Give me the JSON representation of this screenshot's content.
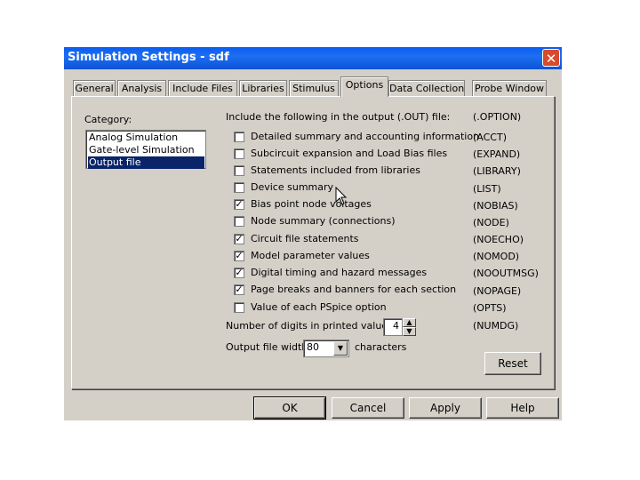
{
  "window": {
    "title": "Simulation Settings - sdf",
    "close_glyph": "✕"
  },
  "tabs": [
    {
      "label": "General"
    },
    {
      "label": "Analysis"
    },
    {
      "label": "Include Files"
    },
    {
      "label": "Libraries"
    },
    {
      "label": "Stimulus"
    },
    {
      "label": "Options"
    },
    {
      "label": "Data Collection"
    },
    {
      "label": "Probe Window"
    }
  ],
  "category": {
    "label": "Category:",
    "items": [
      "Analog Simulation",
      "Gate-level Simulation",
      "Output file"
    ],
    "selected_index": 2
  },
  "output": {
    "header": "Include the following in the output (.OUT) file:",
    "header_option": "(.OPTION)",
    "options": [
      {
        "label": "Detailed summary and accounting information",
        "code": "(ACCT)",
        "checked": false
      },
      {
        "label": "Subcircuit expansion and Load Bias files",
        "code": "(EXPAND)",
        "checked": false
      },
      {
        "label": "Statements included from libraries",
        "code": "(LIBRARY)",
        "checked": false
      },
      {
        "label": "Device summary",
        "code": "(LIST)",
        "checked": false
      },
      {
        "label": "Bias point node voltages",
        "code": "(NOBIAS)",
        "checked": true
      },
      {
        "label": "Node summary (connections)",
        "code": "(NODE)",
        "checked": false
      },
      {
        "label": "Circuit file statements",
        "code": "(NOECHO)",
        "checked": true
      },
      {
        "label": "Model parameter values",
        "code": "(NOMOD)",
        "checked": true
      },
      {
        "label": "Digital timing and hazard messages",
        "code": "(NOOUTMSG)",
        "checked": true
      },
      {
        "label": "Page breaks and banners for each section",
        "code": "(NOPAGE)",
        "checked": true
      },
      {
        "label": "Value of each PSpice option",
        "code": "(OPTS)",
        "checked": false
      }
    ],
    "digits_label": "Number of digits in printed values:",
    "digits_value": "4",
    "digits_code": "(NUMDG)",
    "width_label": "Output file width:",
    "width_value": "80",
    "width_suffix": "characters",
    "reset_label": "Reset"
  },
  "buttons": {
    "ok": "OK",
    "cancel": "Cancel",
    "apply": "Apply",
    "help": "Help"
  },
  "check_glyph": "✓",
  "colors": {
    "titlebar": "#0a5cf0",
    "face": "#d4d0c8",
    "selection": "#0a246a"
  }
}
